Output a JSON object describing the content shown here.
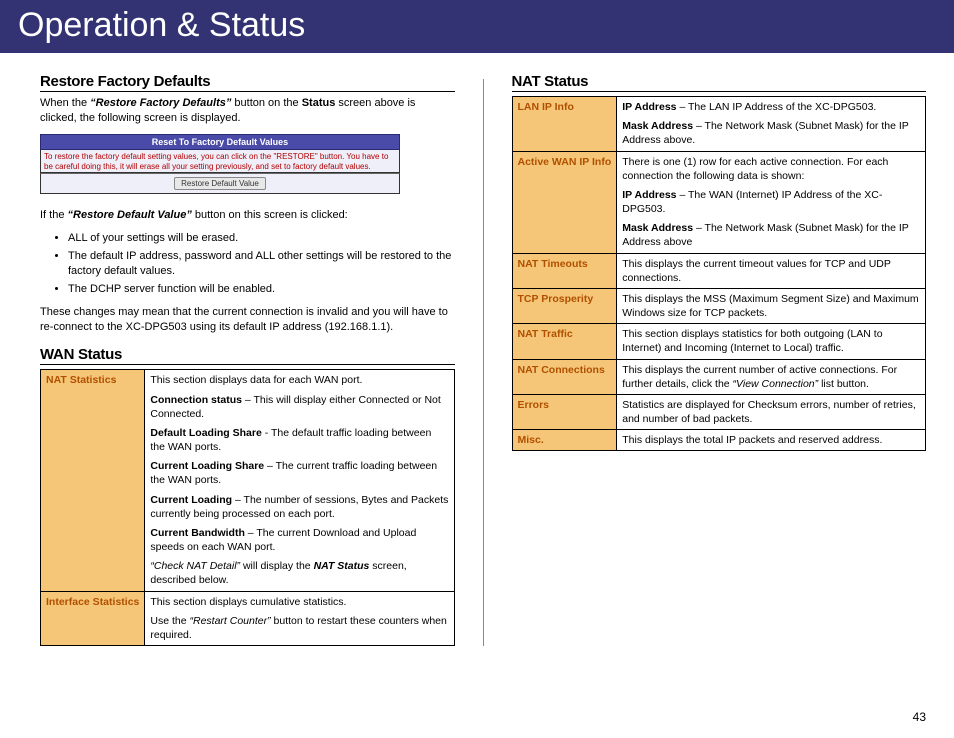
{
  "header": {
    "title": "Operation & Status"
  },
  "page_number": "43",
  "left": {
    "restore": {
      "heading": "Restore Factory Defaults",
      "intro_a": "When the ",
      "intro_b": "“Restore Factory Defaults”",
      "intro_c": " button on the ",
      "intro_d": "Status",
      "intro_e": " screen above is clicked, the following screen is displayed.",
      "ss_title": "Reset To Factory Default Values",
      "ss_body": "To restore the factory default setting values, you can click on the \"RESTORE\" button. You have to be careful doing this, it will erase all your setting previously, and set to factory default values.",
      "ss_button": "Restore Default Value",
      "after_a": "If the ",
      "after_b": "“Restore Default Value”",
      "after_c": " button on this screen is clicked:",
      "bullets": [
        "ALL of your settings will be erased.",
        "The default IP address, password and ALL other settings will be restored to the factory default values.",
        "The DCHP server function will be enabled."
      ],
      "outro": "These changes may mean that the current connection is invalid and you will have to re-connect to the XC-DPG503 using its default IP address (192.168.1.1)."
    },
    "wan": {
      "heading": "WAN Status",
      "rows": [
        {
          "key": "NAT Statistics",
          "paras": [
            {
              "plain": "This section displays data for each WAN port."
            },
            {
              "bold": "Connection status",
              "rest": " – This will display either Connected or Not Connected."
            },
            {
              "bold": "Default Loading Share",
              "rest": " - The default traffic loading between the WAN ports."
            },
            {
              "bold": "Current Loading Share",
              "rest": " – The current traffic loading between the WAN ports."
            },
            {
              "bold": "Current Loading",
              "rest": " – The number of sessions, Bytes and Packets currently being processed on each port."
            },
            {
              "bold": "Current Bandwidth",
              "rest": " – The current Download and Upload speeds on each WAN port."
            },
            {
              "ital": "“Check NAT Detail”",
              "mid": " will display the ",
              "boldital": "NAT Status",
              "rest2": " screen, described below."
            }
          ]
        },
        {
          "key": "Interface Statistics",
          "paras": [
            {
              "plain": "This section displays cumulative statistics."
            },
            {
              "pre": "Use the ",
              "ital": "“Restart Counter”",
              "rest": " button to restart these counters when required."
            }
          ]
        }
      ]
    }
  },
  "right": {
    "nat": {
      "heading": "NAT Status",
      "rows": [
        {
          "key": "LAN IP Info",
          "paras": [
            {
              "bold": "IP Address",
              "rest": " – The LAN IP Address of the XC-DPG503."
            },
            {
              "bold": "Mask Address",
              "rest": " – The Network Mask (Subnet Mask) for the IP Address above."
            }
          ]
        },
        {
          "key": "Active WAN IP Info",
          "paras": [
            {
              "plain": "There is one (1) row for each active connection. For each connection the following data is shown:"
            },
            {
              "bold": "IP Address",
              "rest": " – The WAN (Internet) IP Address of the XC-DPG503."
            },
            {
              "bold": "Mask Address",
              "rest": " – The Network Mask (Subnet Mask) for the IP Address above"
            }
          ]
        },
        {
          "key": "NAT Timeouts",
          "paras": [
            {
              "plain": "This displays the current timeout values for TCP and UDP connections."
            }
          ]
        },
        {
          "key": "TCP Prosperity",
          "paras": [
            {
              "plain": "This displays the MSS (Maximum Segment Size) and Maximum Windows size for TCP packets."
            }
          ]
        },
        {
          "key": "NAT Traffic",
          "paras": [
            {
              "plain": "This section displays statistics for both outgoing (LAN to Internet) and Incoming (Internet to Local) traffic."
            }
          ]
        },
        {
          "key": "NAT Connections",
          "paras": [
            {
              "pre": "This displays the current number of active connections. For further details, click the ",
              "ital": "“View Connection”",
              "rest": " list button."
            }
          ]
        },
        {
          "key": "Errors",
          "paras": [
            {
              "plain": "Statistics are displayed for Checksum errors, number of retries, and number of bad packets."
            }
          ]
        },
        {
          "key": "Misc.",
          "paras": [
            {
              "plain": "This displays the total IP packets and reserved address."
            }
          ]
        }
      ]
    }
  }
}
